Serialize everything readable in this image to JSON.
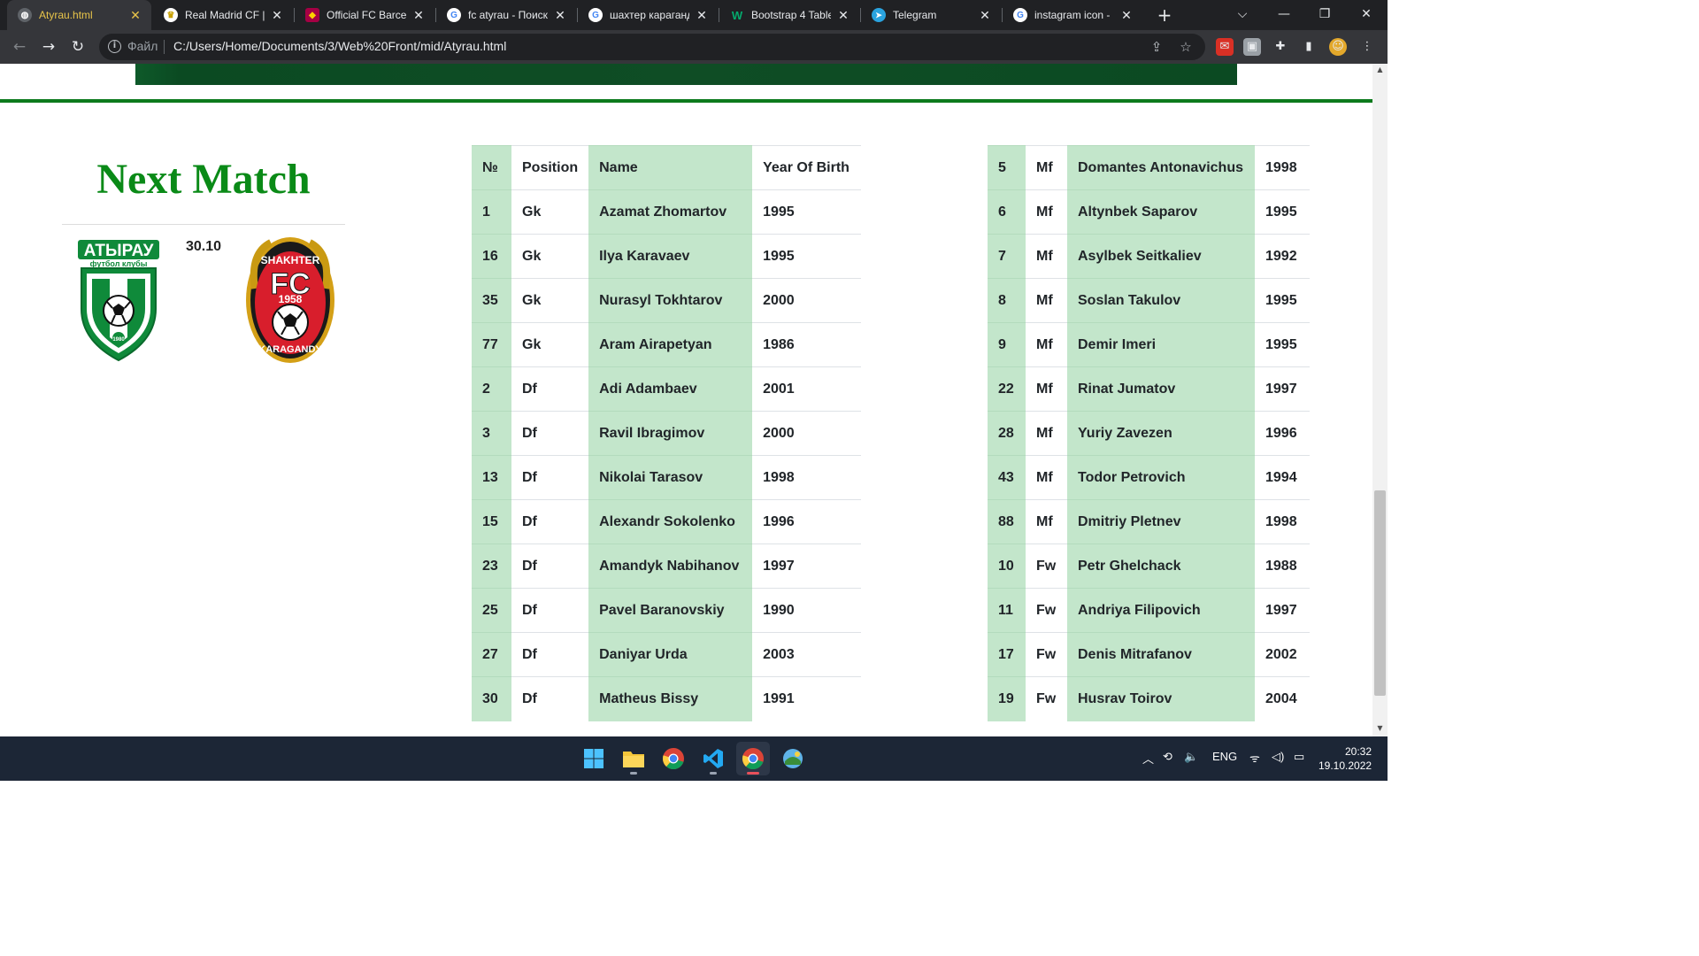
{
  "browser": {
    "tabs": [
      {
        "title": "Atyrau.html",
        "active": true,
        "favicon": "globe-icon"
      },
      {
        "title": "Real Madrid CF | R",
        "active": false,
        "favicon": "real-madrid-icon"
      },
      {
        "title": "Official FC Barcelo",
        "active": false,
        "favicon": "barcelona-icon"
      },
      {
        "title": "fc atyrau - Поиск",
        "active": false,
        "favicon": "google-icon"
      },
      {
        "title": "шахтер караганд",
        "active": false,
        "favicon": "google-icon"
      },
      {
        "title": "Bootstrap 4 Table",
        "active": false,
        "favicon": "w3schools-icon"
      },
      {
        "title": "Telegram",
        "active": false,
        "favicon": "telegram-icon"
      },
      {
        "title": "instagram icon - ",
        "active": false,
        "favicon": "google-icon"
      }
    ],
    "address": {
      "scheme_label": "Файл",
      "url": "C:/Users/Home/Documents/3/Web%20Front/mid/Atyrau.html"
    }
  },
  "page": {
    "next_match": {
      "title": "Next Match",
      "date": "30.10",
      "home_team": {
        "name": "Atyrau",
        "logo_text": "АТЫРАУ",
        "logo_subtext": "футбол клубы",
        "logo_year": "1980"
      },
      "away_team": {
        "name": "Shakhter Karagandy",
        "logo_top": "SHAKHTER",
        "logo_fc": "FC",
        "logo_year": "1958",
        "logo_bottom": "KARAGANDY"
      }
    },
    "squad_table_1": {
      "headers": [
        "№",
        "Position",
        "Name",
        "Year Of Birth"
      ],
      "rows": [
        [
          "1",
          "Gk",
          "Azamat Zhomartov",
          "1995"
        ],
        [
          "16",
          "Gk",
          "Ilya Karavaev",
          "1995"
        ],
        [
          "35",
          "Gk",
          "Nurasyl Tokhtarov",
          "2000"
        ],
        [
          "77",
          "Gk",
          "Aram Airapetyan",
          "1986"
        ],
        [
          "2",
          "Df",
          "Adi Adambaev",
          "2001"
        ],
        [
          "3",
          "Df",
          "Ravil Ibragimov",
          "2000"
        ],
        [
          "13",
          "Df",
          "Nikolai Tarasov",
          "1998"
        ],
        [
          "15",
          "Df",
          "Alexandr Sokolenko",
          "1996"
        ],
        [
          "23",
          "Df",
          "Amandyk Nabihanov",
          "1997"
        ],
        [
          "25",
          "Df",
          "Pavel Baranovskiy",
          "1990"
        ],
        [
          "27",
          "Df",
          "Daniyar Urda",
          "2003"
        ],
        [
          "30",
          "Df",
          "Matheus Bissy",
          "1991"
        ]
      ]
    },
    "squad_table_2": {
      "rows": [
        [
          "5",
          "Mf",
          "Domantes Antonavichus",
          "1998"
        ],
        [
          "6",
          "Mf",
          "Altynbek Saparov",
          "1995"
        ],
        [
          "7",
          "Mf",
          "Asylbek Seitkaliev",
          "1992"
        ],
        [
          "8",
          "Mf",
          "Soslan Takulov",
          "1995"
        ],
        [
          "9",
          "Mf",
          "Demir Imeri",
          "1995"
        ],
        [
          "22",
          "Mf",
          "Rinat Jumatov",
          "1997"
        ],
        [
          "28",
          "Mf",
          "Yuriy Zavezen",
          "1996"
        ],
        [
          "43",
          "Mf",
          "Todor Petrovich",
          "1994"
        ],
        [
          "88",
          "Mf",
          "Dmitriy Pletnev",
          "1998"
        ],
        [
          "10",
          "Fw",
          "Petr Ghelchack",
          "1988"
        ],
        [
          "11",
          "Fw",
          "Andriya Filipovich",
          "1997"
        ],
        [
          "17",
          "Fw",
          "Denis Mitrafanov",
          "2002"
        ],
        [
          "19",
          "Fw",
          "Husrav Toirov",
          "2004"
        ]
      ]
    }
  },
  "taskbar": {
    "apps": [
      "windows-start-icon",
      "file-explorer-icon",
      "chrome-icon",
      "vscode-icon",
      "chrome-icon",
      "control-panel-icon"
    ],
    "tray": {
      "language": "ENG",
      "time": "20:32",
      "date": "19.10.2022"
    }
  },
  "colors": {
    "accent_green": "#0a8a17",
    "table_highlight": "#c3e6cb",
    "divider_green": "#0c7a1d",
    "active_tab_text": "#e8c44a"
  }
}
